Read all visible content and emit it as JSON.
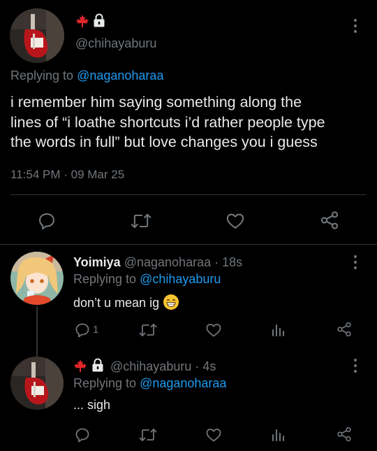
{
  "main_tweet": {
    "handle": "@chihayaburu",
    "replying_to_prefix": "Replying to",
    "replying_to_handle": "@naganoharaa",
    "text_line1": "i remember him saying something along the",
    "text_line2": "lines of “i loathe shortcuts i’d rather people type",
    "text_line3": "the words in full” but love changes you i guess",
    "timestamp": "11:54 PM · 09 Mar 25"
  },
  "reply1": {
    "name": "Yoimiya",
    "handle": "@naganoharaa",
    "time": "· 18s",
    "replying_to_prefix": "Replying to",
    "replying_to_handle": "@chihayaburu",
    "text": "don’t u mean ig",
    "reply_count": "1"
  },
  "reply2": {
    "handle": "@chihayaburu",
    "time": "· 4s",
    "replying_to_prefix": "Replying to",
    "replying_to_handle": "@naganoharaa",
    "text": "... sigh"
  },
  "colors": {
    "background": "#000000",
    "text": "#e7e9ea",
    "secondary": "#71767b",
    "link": "#1d9bf0",
    "maple_leaf": "#e0262b"
  },
  "icons": [
    "maple-leaf-icon",
    "lock-icon",
    "more-icon",
    "reply-icon",
    "retweet-icon",
    "like-icon",
    "share-icon",
    "analytics-icon",
    "grinning-emoji"
  ]
}
